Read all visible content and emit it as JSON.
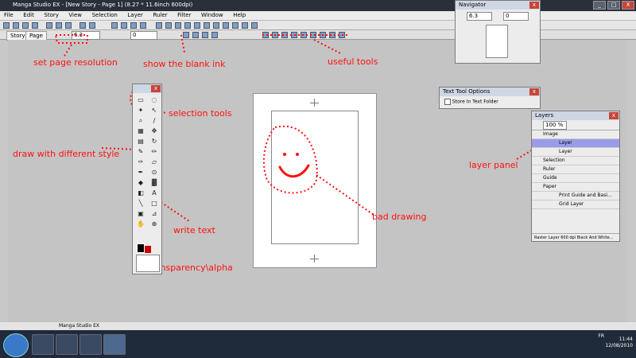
{
  "window": {
    "title": "Manga Studio EX - [New Story - Page 1] (8.27 * 11.6inch 600dpi)",
    "min": "_",
    "max": "□",
    "close": "X"
  },
  "menu": [
    "File",
    "Edit",
    "Story",
    "View",
    "Selection",
    "Layer",
    "Ruler",
    "Filter",
    "Window",
    "Help"
  ],
  "pagebar": {
    "tab_story": "Story",
    "tab_page": "Page",
    "zoom_value": "6.3",
    "angle_value": "0"
  },
  "navigator": {
    "title": "Navigator",
    "zoom": "6.3",
    "angle": "0"
  },
  "text_tool_options": {
    "title": "Text Tool Options",
    "checkbox_label": "Store In Text Folder"
  },
  "layers": {
    "title": "Layers",
    "opacity": "100 %",
    "rows": [
      {
        "label": "Image",
        "selected": false,
        "sub": false
      },
      {
        "label": "Layer",
        "selected": true,
        "sub": true
      },
      {
        "label": "Layer",
        "selected": false,
        "sub": true
      },
      {
        "label": "Selection",
        "selected": false,
        "sub": false
      },
      {
        "label": "Ruler",
        "selected": false,
        "sub": false
      },
      {
        "label": "Guide",
        "selected": false,
        "sub": false
      },
      {
        "label": "Paper",
        "selected": false,
        "sub": false
      },
      {
        "label": "Print Guide and Basi...",
        "selected": false,
        "sub": true
      },
      {
        "label": "Grid Layer",
        "selected": false,
        "sub": true
      }
    ],
    "status": "Raster Layer 600 dpi Black And White..."
  },
  "statusbar": {
    "app": "Manga Studio EX"
  },
  "taskbar": {
    "lang": "FR",
    "time": "11:44",
    "date": "12/08/2010"
  },
  "annotations": {
    "set_page_resolution": "set page resolution",
    "show_blank_ink": "show the blank ink",
    "useful_tools": "useful tools",
    "selection_tools": "selection tools",
    "draw_style": "draw with different style",
    "write_text": "write text",
    "transparency": "transparency\\alpha",
    "layer_panel": "layer panel",
    "bad_drawing": "bad drawing"
  },
  "colors": {
    "annotation": "#ff1010",
    "selected_layer": "#9a9ce8"
  }
}
